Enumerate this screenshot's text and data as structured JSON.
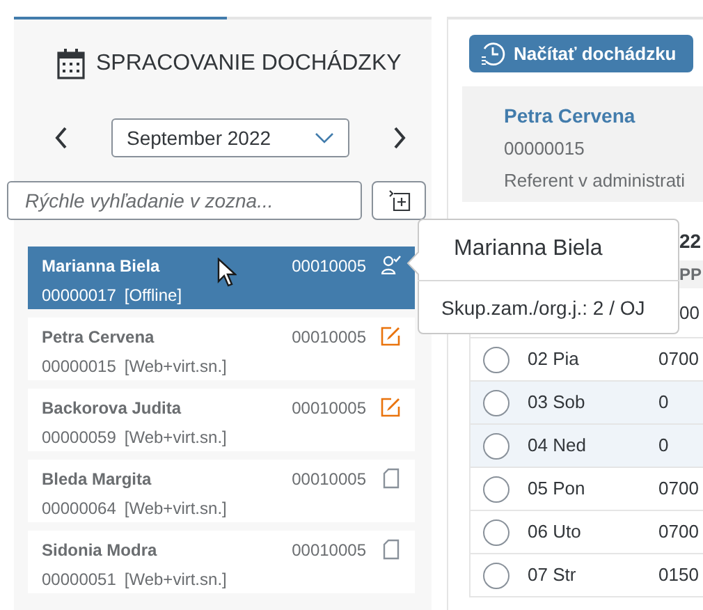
{
  "header": {
    "title": "SPRACOVANIE DOCHÁDZKY"
  },
  "period": {
    "value": "September 2022"
  },
  "search": {
    "placeholder": "Rýchle vyhľadanie v zozna..."
  },
  "employees": [
    {
      "name": "Marianna Biela",
      "id": "00000017",
      "mode": "[Offline]",
      "unit": "00010005",
      "kind": "assigned",
      "selected": true
    },
    {
      "name": "Petra Cervena",
      "id": "00000015",
      "mode": "[Web+virt.sn.]",
      "unit": "00010005",
      "kind": "edited",
      "selected": false
    },
    {
      "name": "Backorova Judita",
      "id": "00000059",
      "mode": "[Web+virt.sn.]",
      "unit": "00010005",
      "kind": "edited",
      "selected": false
    },
    {
      "name": "Bleda Margita",
      "id": "00000064",
      "mode": "[Web+virt.sn.]",
      "unit": "00010005",
      "kind": "blank",
      "selected": false
    },
    {
      "name": "Sidonia Modra",
      "id": "00000051",
      "mode": "[Web+virt.sn.]",
      "unit": "00010005",
      "kind": "blank",
      "selected": false
    }
  ],
  "load_button": {
    "label": "Načítať dochádzku"
  },
  "detail": {
    "name": "Petra Cervena",
    "id": "00000015",
    "position": "Referent v administrati"
  },
  "table": {
    "title": "22",
    "column_2": "PP",
    "rows": [
      {
        "value": "00"
      },
      {
        "day": "02 Pia",
        "value": "0700",
        "weekend": false
      },
      {
        "day": "03 Sob",
        "value": "0",
        "weekend": true
      },
      {
        "day": "04 Ned",
        "value": "0",
        "weekend": true
      },
      {
        "day": "05 Pon",
        "value": "0700",
        "weekend": false
      },
      {
        "day": "06 Uto",
        "value": "0700",
        "weekend": false
      },
      {
        "day": "07 Str",
        "value": "0150",
        "weekend": false
      }
    ]
  },
  "tooltip": {
    "title": "Marianna Biela",
    "detail": "Skup.zam./org.j.: 2 / OJ"
  }
}
